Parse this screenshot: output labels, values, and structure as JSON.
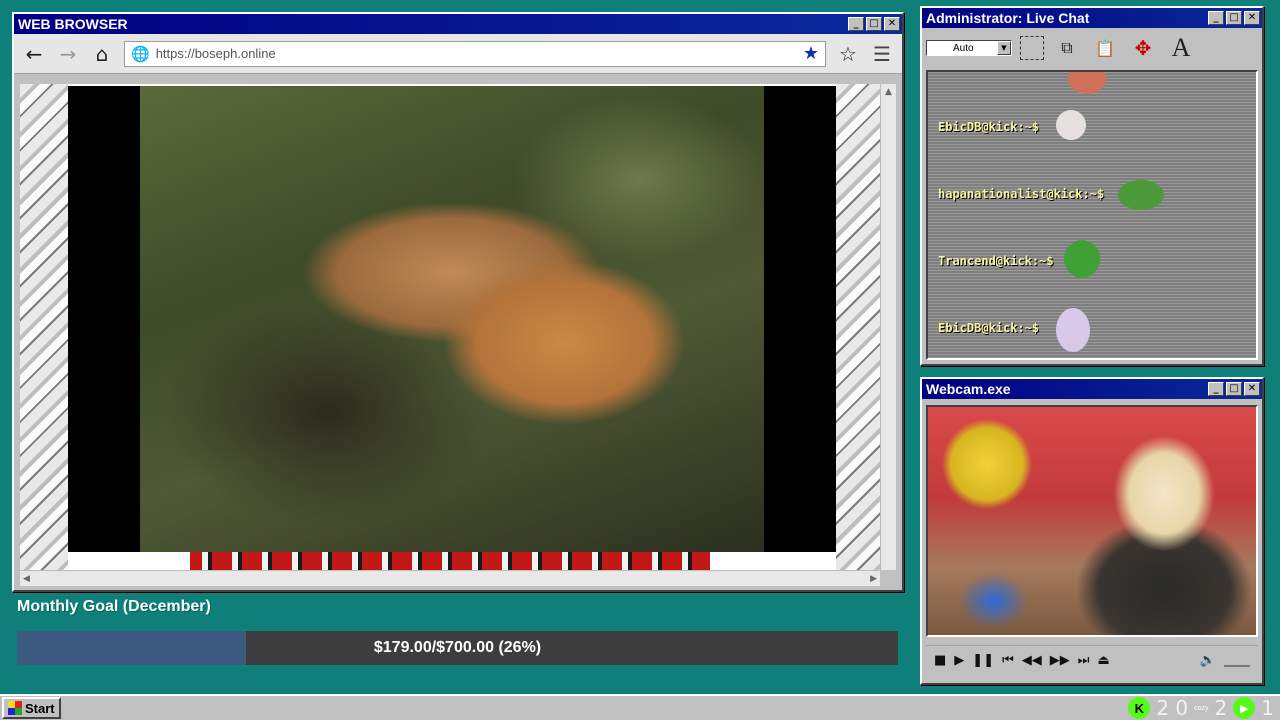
{
  "browser": {
    "title": "WEB BROWSER",
    "url": "https://boseph.online",
    "controls": {
      "minimize": "_",
      "maximize": "□",
      "close": "✕"
    }
  },
  "nav": {
    "back_icon": "←",
    "forward_icon": "→",
    "home_icon": "⌂",
    "globe_icon": "🌐",
    "bookmark_filled_icon": "★",
    "bookmark_outline_icon": "☆",
    "menu_icon": "☰"
  },
  "goal": {
    "title": "Monthly Goal (December)",
    "text": "$179.00/$700.00 (26%)",
    "progress_fraction": 0.26
  },
  "chat": {
    "title": "Administrator: Live Chat",
    "font_size_value": "Auto",
    "messages": [
      {
        "user": "EbicDB@kick:~$"
      },
      {
        "user": "hapanationalist@kick:~$"
      },
      {
        "user": "Trancend@kick:~$"
      },
      {
        "user": "EbicDB@kick:~$"
      }
    ]
  },
  "webcam": {
    "title": "Webcam.exe"
  },
  "taskbar": {
    "start_label": "Start",
    "tray_viewers": "2 0",
    "tray_cozy": "cozy",
    "tray_count_a": "2",
    "tray_count_b": "1",
    "kick_letter": "K"
  },
  "colors": {
    "desktop": "#0f7f7a",
    "titlebar": "#000080",
    "goal_fill": "#3d5a80",
    "kick_green": "#53fc18",
    "chat_username": "#f5f5a0"
  }
}
